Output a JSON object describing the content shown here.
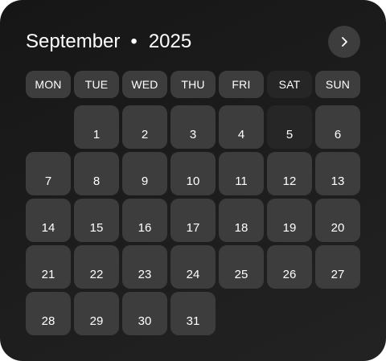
{
  "header": {
    "month": "September",
    "separator": "•",
    "year": "2025"
  },
  "nav": {
    "next_icon": "chevron-right-icon"
  },
  "weekdays": [
    "MON",
    "TUE",
    "WED",
    "THU",
    "FRI",
    "SAT",
    "SUN"
  ],
  "days": [
    "1",
    "2",
    "3",
    "4",
    "5",
    "6",
    "7",
    "8",
    "9",
    "10",
    "11",
    "12",
    "13",
    "14",
    "15",
    "16",
    "17",
    "18",
    "19",
    "20",
    "21",
    "22",
    "23",
    "24",
    "25",
    "26",
    "27",
    "28",
    "29",
    "30",
    "31"
  ],
  "colors": {
    "card": "#1c1c1c",
    "tile": "#3d3d3d",
    "weekend_tile": "#262626",
    "text": "#ffffff"
  }
}
